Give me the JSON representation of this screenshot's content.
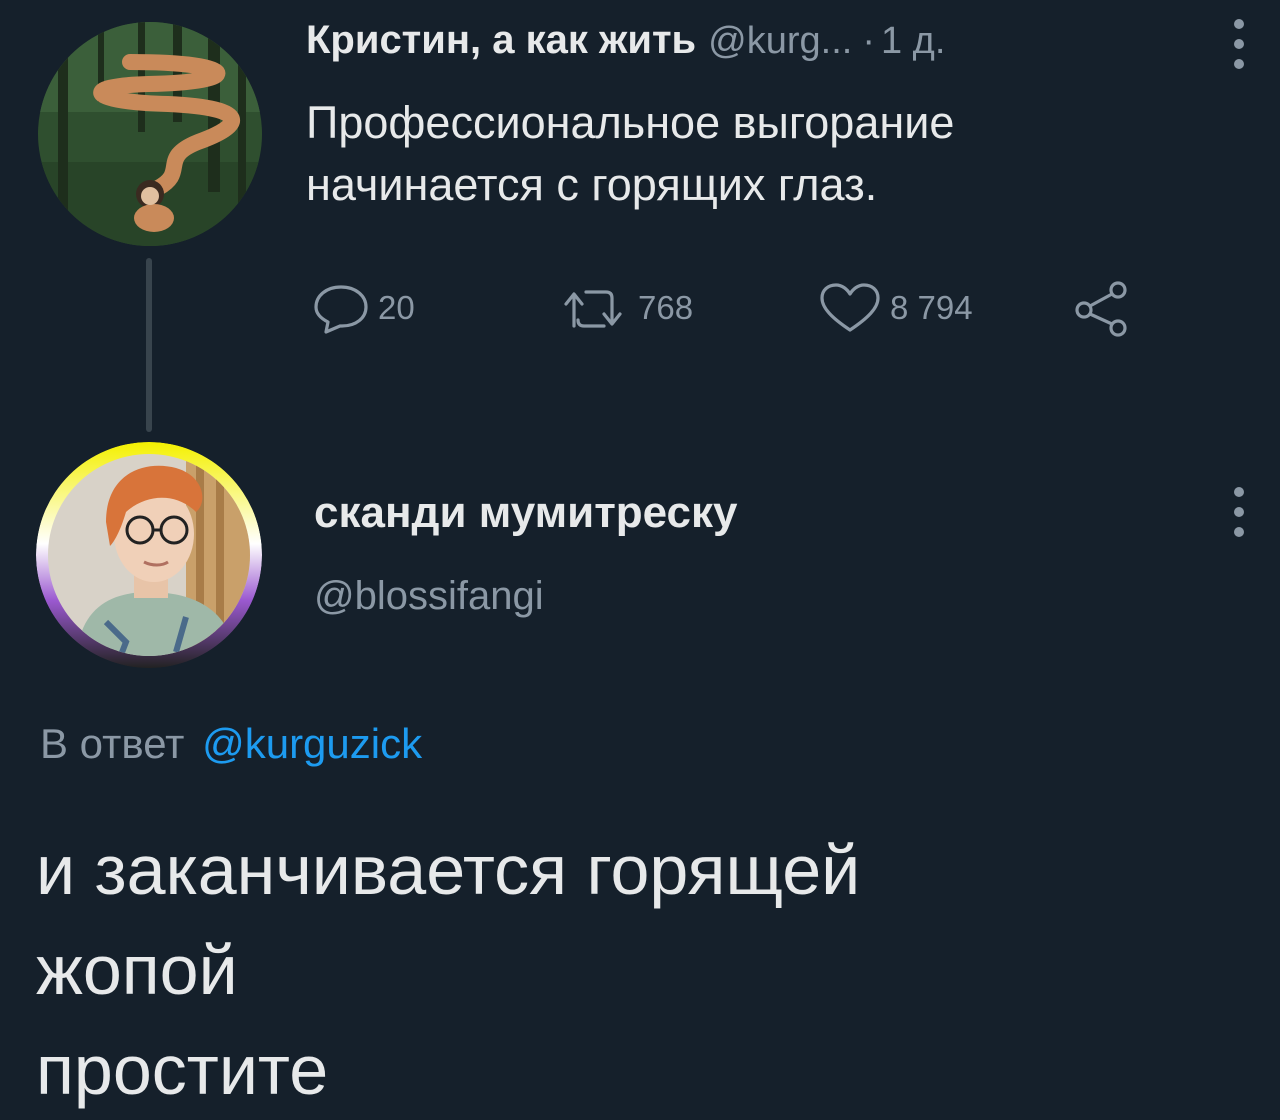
{
  "colors": {
    "background": "#15202b",
    "text_primary": "#e7e9ea",
    "text_secondary": "#8b98a5",
    "accent_link": "#1d9bf0",
    "thread_line": "#38444d"
  },
  "parent_tweet": {
    "author_name": "Кристин, а как жить",
    "author_handle": "@kurg...",
    "separator": "·",
    "time": "1 д.",
    "text_lines": [
      "Профессиональное выгорание",
      "начинается с горящих глаз."
    ],
    "actions": {
      "reply_icon": "reply-icon",
      "reply_count": "20",
      "retweet_icon": "retweet-icon",
      "retweet_count": "768",
      "like_icon": "heart-icon",
      "like_count": "8 794",
      "share_icon": "share-icon"
    },
    "more_icon": "more-vertical-icon"
  },
  "reply_tweet": {
    "author_name": "сканди мумитреску",
    "author_handle": "@blossifangi",
    "reply_to_label": "В ответ",
    "reply_to_mention": "@kurguzick",
    "text_lines": [
      "и заканчивается горящей",
      "жопой",
      "простите"
    ],
    "more_icon": "more-vertical-icon"
  }
}
